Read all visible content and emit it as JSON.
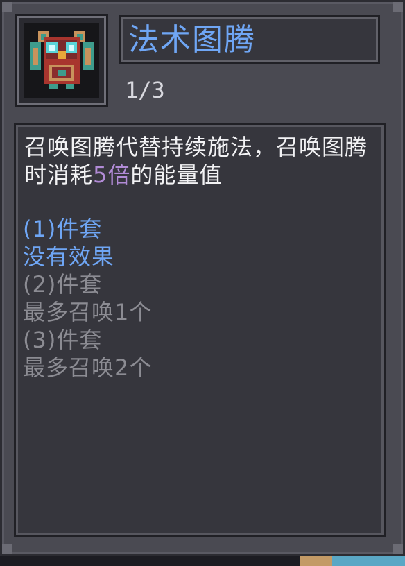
{
  "item": {
    "title": "法术图腾",
    "count": "1/3",
    "icon": "owl-totem-icon"
  },
  "description": {
    "part1": "召唤图腾代替持续施法，召唤图腾时消耗",
    "highlight": "5倍",
    "part2": "的能量值",
    "highlight_color": "#b18bd6"
  },
  "set_bonuses": [
    {
      "label": "(1)件套",
      "effect": "没有效果",
      "active": true
    },
    {
      "label": "(2)件套",
      "effect": "最多召唤1个",
      "active": false
    },
    {
      "label": "(3)件套",
      "effect": "最多召唤2个",
      "active": false
    }
  ],
  "colors": {
    "title": "#6fa6f5",
    "active": "#6fa6f5",
    "inactive": "#8c8c93",
    "text": "#f2f2f4"
  }
}
